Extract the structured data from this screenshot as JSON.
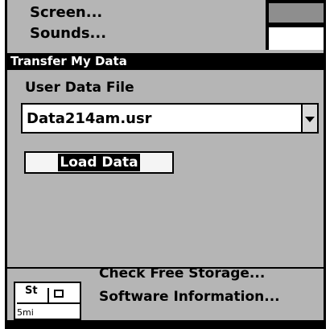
{
  "background_menu": {
    "items": [
      "Screen...",
      "Sounds..."
    ]
  },
  "dialog": {
    "title": "Transfer My Data",
    "field_label": "User Data File",
    "file_select": {
      "value": "Data214am.usr"
    },
    "load_button": "Load Data"
  },
  "bottom_menu": {
    "items": [
      "Check Free Storage...",
      "Software Information..."
    ]
  },
  "minimap": {
    "road_label": "St",
    "scale_label": "5mi"
  }
}
